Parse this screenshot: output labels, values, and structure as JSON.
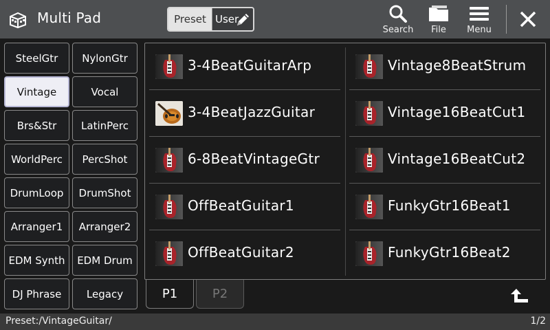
{
  "header": {
    "title": "Multi Pad",
    "preset_label": "Preset",
    "user_label": "User",
    "search_label": "Search",
    "file_label": "File",
    "menu_label": "Menu"
  },
  "categories": [
    {
      "label": "SteelGtr",
      "selected": false
    },
    {
      "label": "NylonGtr",
      "selected": false
    },
    {
      "label": "Vintage",
      "selected": true
    },
    {
      "label": "Vocal",
      "selected": false
    },
    {
      "label": "Brs&Str",
      "selected": false
    },
    {
      "label": "LatinPerc",
      "selected": false
    },
    {
      "label": "WorldPerc",
      "selected": false
    },
    {
      "label": "PercShot",
      "selected": false
    },
    {
      "label": "DrumLoop",
      "selected": false
    },
    {
      "label": "DrumShot",
      "selected": false
    },
    {
      "label": "Arranger1",
      "selected": false
    },
    {
      "label": "Arranger2",
      "selected": false
    },
    {
      "label": "EDM Synth",
      "selected": false
    },
    {
      "label": "EDM Drum",
      "selected": false
    },
    {
      "label": "DJ Phrase",
      "selected": false
    },
    {
      "label": "Legacy",
      "selected": false
    }
  ],
  "items": [
    {
      "label": "3-4BeatGuitarArp",
      "icon": "electric-guitar-icon"
    },
    {
      "label": "Vintage8BeatStrum",
      "icon": "electric-guitar-icon"
    },
    {
      "label": "3-4BeatJazzGuitar",
      "icon": "jazz-guitar-icon"
    },
    {
      "label": "Vintage16BeatCut1",
      "icon": "electric-guitar-icon"
    },
    {
      "label": "6-8BeatVintageGtr",
      "icon": "electric-guitar-icon"
    },
    {
      "label": "Vintage16BeatCut2",
      "icon": "electric-guitar-icon"
    },
    {
      "label": "OffBeatGuitar1",
      "icon": "electric-guitar-icon"
    },
    {
      "label": "FunkyGtr16Beat1",
      "icon": "electric-guitar-icon"
    },
    {
      "label": "OffBeatGuitar2",
      "icon": "electric-guitar-icon"
    },
    {
      "label": "FunkyGtr16Beat2",
      "icon": "electric-guitar-icon"
    }
  ],
  "tabs": [
    {
      "label": "P1",
      "active": true
    },
    {
      "label": "P2",
      "active": false
    }
  ],
  "status": {
    "path": "Preset:/VintageGuitar/",
    "page": "1/2"
  }
}
